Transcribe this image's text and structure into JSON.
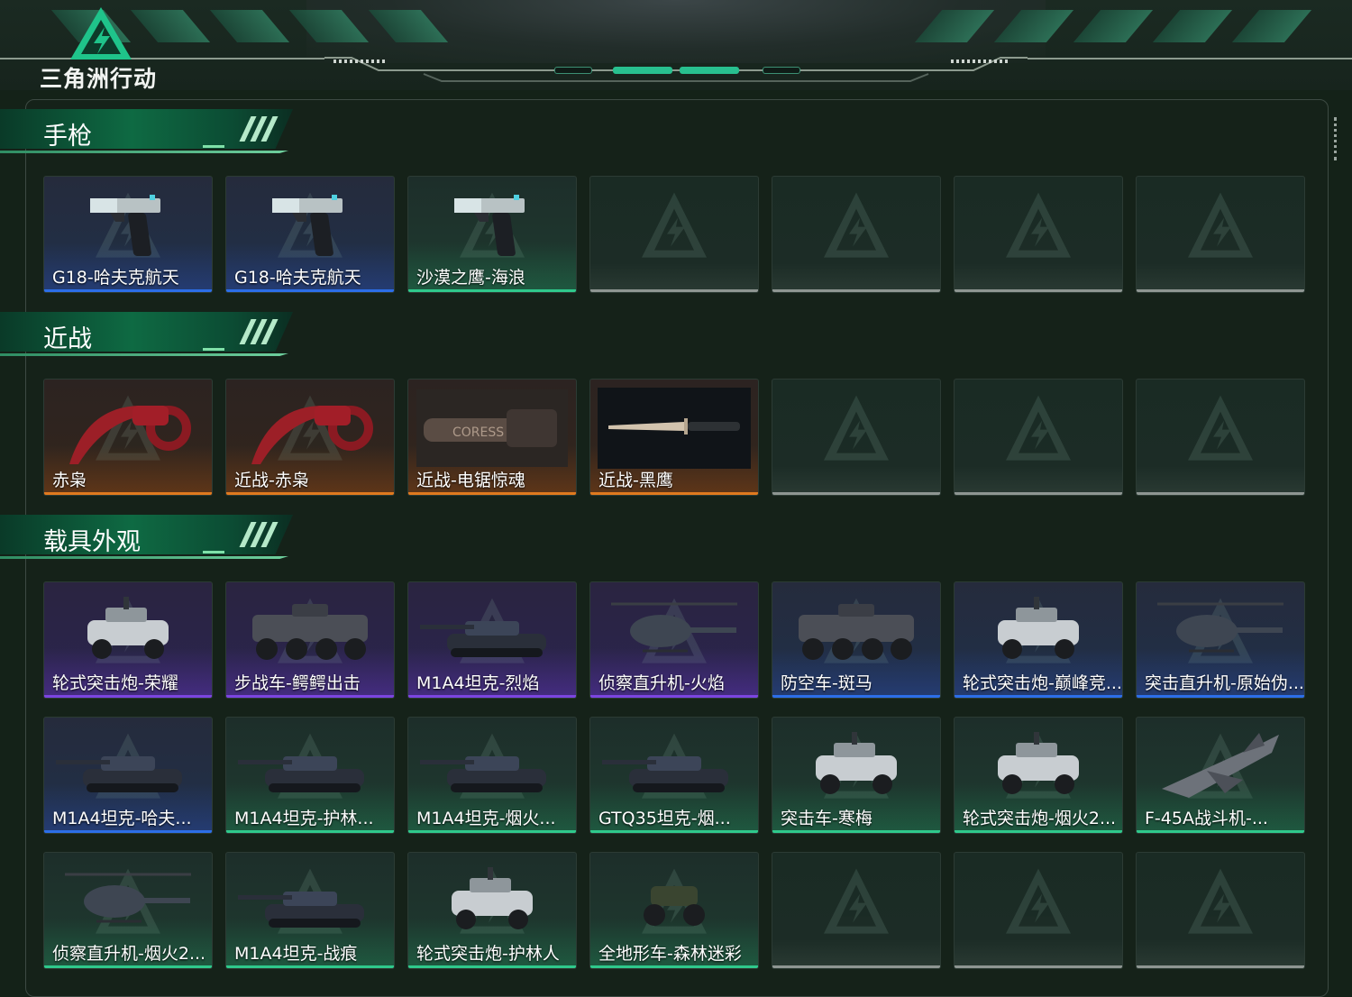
{
  "app": {
    "logo_text": "三角洲行动"
  },
  "sections": [
    {
      "title": "手枪",
      "cards": [
        {
          "name": "G18-哈夫克航天",
          "rarity": "blue",
          "icon": "pistol-icon"
        },
        {
          "name": "G18-哈夫克航天",
          "rarity": "blue",
          "icon": "pistol-icon"
        },
        {
          "name": "沙漠之鹰-海浪",
          "rarity": "green",
          "icon": "pistol-icon"
        },
        {
          "name": "",
          "rarity": "empty"
        },
        {
          "name": "",
          "rarity": "empty"
        },
        {
          "name": "",
          "rarity": "empty"
        },
        {
          "name": "",
          "rarity": "empty"
        }
      ]
    },
    {
      "title": "近战",
      "cards": [
        {
          "name": "赤枭",
          "rarity": "orange",
          "icon": "karambit-icon"
        },
        {
          "name": "近战-赤枭",
          "rarity": "orange",
          "icon": "karambit-icon"
        },
        {
          "name": "近战-电锯惊魂",
          "rarity": "orange",
          "icon": "chainsaw-icon"
        },
        {
          "name": "近战-黑鹰",
          "rarity": "orange",
          "icon": "knife-icon"
        },
        {
          "name": "",
          "rarity": "empty"
        },
        {
          "name": "",
          "rarity": "empty"
        },
        {
          "name": "",
          "rarity": "empty"
        }
      ]
    },
    {
      "title": "载具外观",
      "cards": [
        {
          "name": "轮式突击炮-荣耀",
          "rarity": "purple",
          "icon": "armored-car-icon"
        },
        {
          "name": "步战车-鳄鳄出击",
          "rarity": "purple",
          "icon": "ifv-icon"
        },
        {
          "name": "M1A4坦克-烈焰",
          "rarity": "purple",
          "icon": "tank-icon"
        },
        {
          "name": "侦察直升机-火焰",
          "rarity": "purple",
          "icon": "helicopter-icon"
        },
        {
          "name": "防空车-斑马",
          "rarity": "blue",
          "icon": "ifv-icon"
        },
        {
          "name": "轮式突击炮-巅峰竞...",
          "rarity": "blue",
          "icon": "armored-car-icon"
        },
        {
          "name": "突击直升机-原始伪...",
          "rarity": "blue",
          "icon": "helicopter-icon"
        },
        {
          "name": "M1A4坦克-哈夫...",
          "rarity": "blue",
          "icon": "tank-icon"
        },
        {
          "name": "M1A4坦克-护林...",
          "rarity": "green",
          "icon": "tank-icon"
        },
        {
          "name": "M1A4坦克-烟火...",
          "rarity": "green",
          "icon": "tank-icon"
        },
        {
          "name": "GTQ35坦克-烟...",
          "rarity": "green",
          "icon": "tank-icon"
        },
        {
          "name": "突击车-寒梅",
          "rarity": "green",
          "icon": "armored-car-icon"
        },
        {
          "name": "轮式突击炮-烟火2...",
          "rarity": "green",
          "icon": "armored-car-icon"
        },
        {
          "name": "F-45A战斗机-...",
          "rarity": "green",
          "icon": "jet-icon"
        },
        {
          "name": "侦察直升机-烟火2...",
          "rarity": "green",
          "icon": "helicopter-icon"
        },
        {
          "name": "M1A4坦克-战痕",
          "rarity": "green",
          "icon": "tank-icon"
        },
        {
          "name": "轮式突击炮-护林人",
          "rarity": "green",
          "icon": "armored-car-icon"
        },
        {
          "name": "全地形车-森林迷彩",
          "rarity": "green",
          "icon": "atv-icon"
        },
        {
          "name": "",
          "rarity": "empty"
        },
        {
          "name": "",
          "rarity": "empty"
        },
        {
          "name": "",
          "rarity": "empty"
        }
      ]
    }
  ],
  "colors": {
    "accent": "#28c08f",
    "background": "#152219",
    "blue": "#2c6ee8",
    "purple": "#7b45e0",
    "green": "#2fc98c",
    "orange": "#e07a1f"
  }
}
